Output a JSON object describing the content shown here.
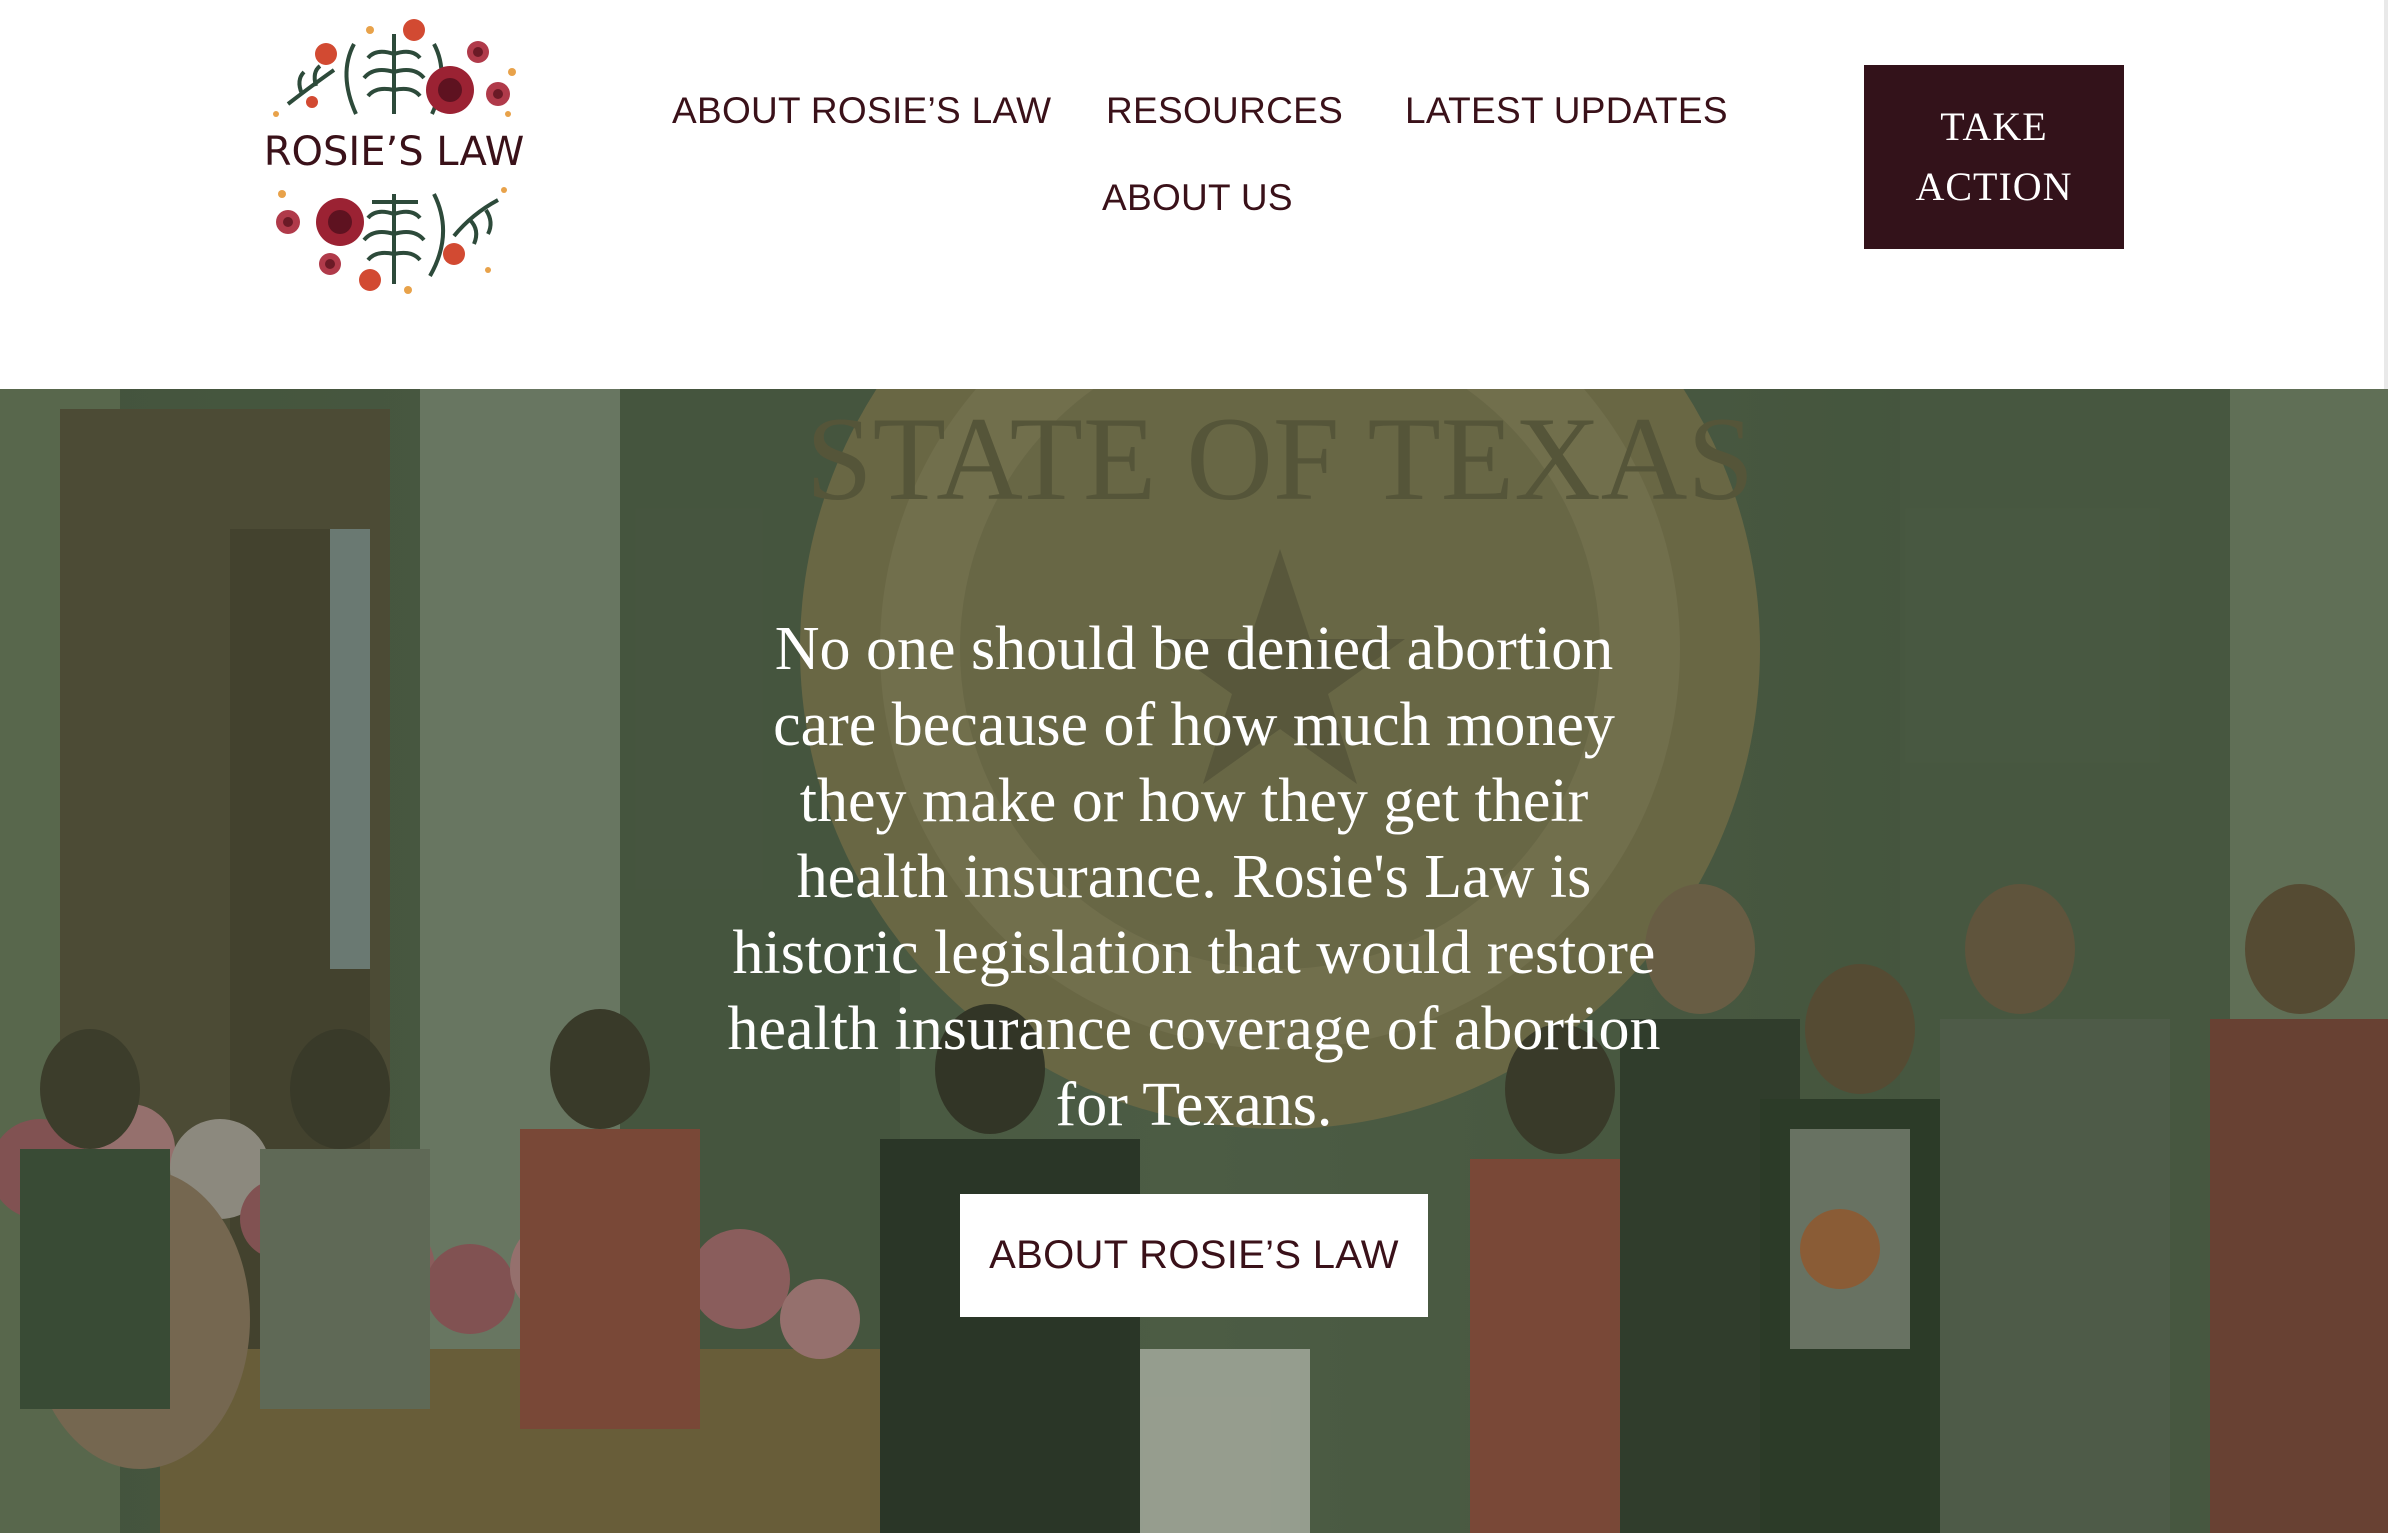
{
  "header": {
    "logo_text": "ROSIE’S LAW",
    "nav": [
      {
        "label": "ABOUT ROSIE’S LAW"
      },
      {
        "label": "RESOURCES"
      },
      {
        "label": "LATEST UPDATES"
      },
      {
        "label": "ABOUT US"
      }
    ],
    "cta_label": "TAKE ACTION"
  },
  "hero": {
    "headline": "No one should be denied abortion care because of how much money they make or how they get their health insurance. Rosie's Law is historic legislation that would restore health insurance coverage of abortion for Texans.",
    "button_label": "ABOUT ROSIE’S LAW",
    "seal_text": "STATE OF TEXAS"
  },
  "colors": {
    "brand_dark": "#33121a",
    "nav_text": "#3a1119",
    "hero_overlay": "#3a4c32",
    "accent_red": "#b33a3a"
  },
  "icons": [
    "rose-icon",
    "leaf-icon",
    "star-icon"
  ]
}
